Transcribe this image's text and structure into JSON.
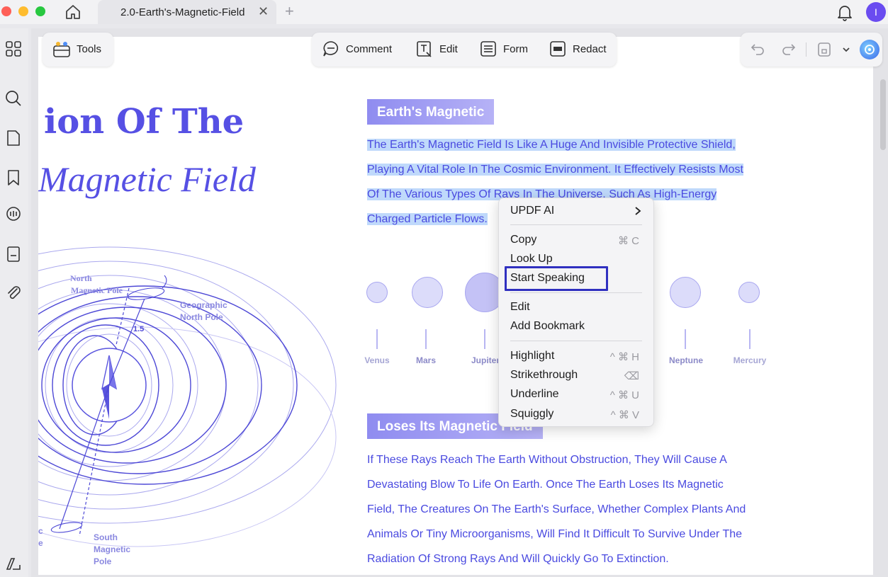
{
  "tab": {
    "title": "2.0-Earth's-Magnetic-Field",
    "add": "+",
    "close": "✕"
  },
  "user": {
    "avatar_letter": "I"
  },
  "toolbar": {
    "tools_label": "Tools",
    "comment_label": "Comment",
    "edit_label": "Edit",
    "form_label": "Form",
    "redact_label": "Redact"
  },
  "page": {
    "title_line1": "ion Of The",
    "title_line2": "Magnetic Field",
    "diagram": {
      "north_magnetic": [
        "North",
        "Magnetic Pole"
      ],
      "geographic_north": [
        "Geographic",
        "North Pole"
      ],
      "angle": "1.5",
      "south_magnetic": [
        "South",
        "Magnetic",
        "Pole"
      ],
      "left_fragment": [
        "c",
        "e"
      ]
    },
    "section1": {
      "heading": "Earth's Magnetic",
      "lines": [
        "The Earth's Magnetic Field Is Like A Huge And Invisible Protective Shield,",
        "Playing A Vital Role In The Cosmic Environment. It Effectively Resists Most",
        "Of The Various Types Of Rays In The Universe, Such As High-Energy",
        "Charged Particle Flows."
      ]
    },
    "planets": [
      "Venus",
      "Mars",
      "Jupiter",
      "Neptune",
      "Mercury"
    ],
    "section2": {
      "heading": "Loses Its Magnetic Field",
      "lines": [
        "If These Rays Reach The Earth Without Obstruction, They Will Cause A",
        "Devastating Blow To Life On Earth. Once The Earth Loses Its Magnetic",
        "Field, The Creatures On The Earth's Surface, Whether Complex Plants And",
        "Animals Or Tiny Microorganisms, Will Find It Difficult To Survive Under The",
        "Radiation Of Strong Rays And Will Quickly Go To Extinction."
      ]
    }
  },
  "context_menu": {
    "updf_ai": "UPDF AI",
    "copy": "Copy",
    "copy_shortcut": "⌘ C",
    "look_up": "Look Up",
    "start_speaking": "Start Speaking",
    "edit": "Edit",
    "add_bookmark": "Add Bookmark",
    "highlight": "Highlight",
    "highlight_shortcut": "^ ⌘ H",
    "strikethrough": "Strikethrough",
    "strikethrough_shortcut": "⌫",
    "underline": "Underline",
    "underline_shortcut": "^ ⌘ U",
    "squiggly": "Squiggly",
    "squiggly_shortcut": "^ ⌘ V"
  },
  "colors": {
    "accent": "#5650e4",
    "selection": "#bfd9fb",
    "focus": "#3030c0"
  }
}
